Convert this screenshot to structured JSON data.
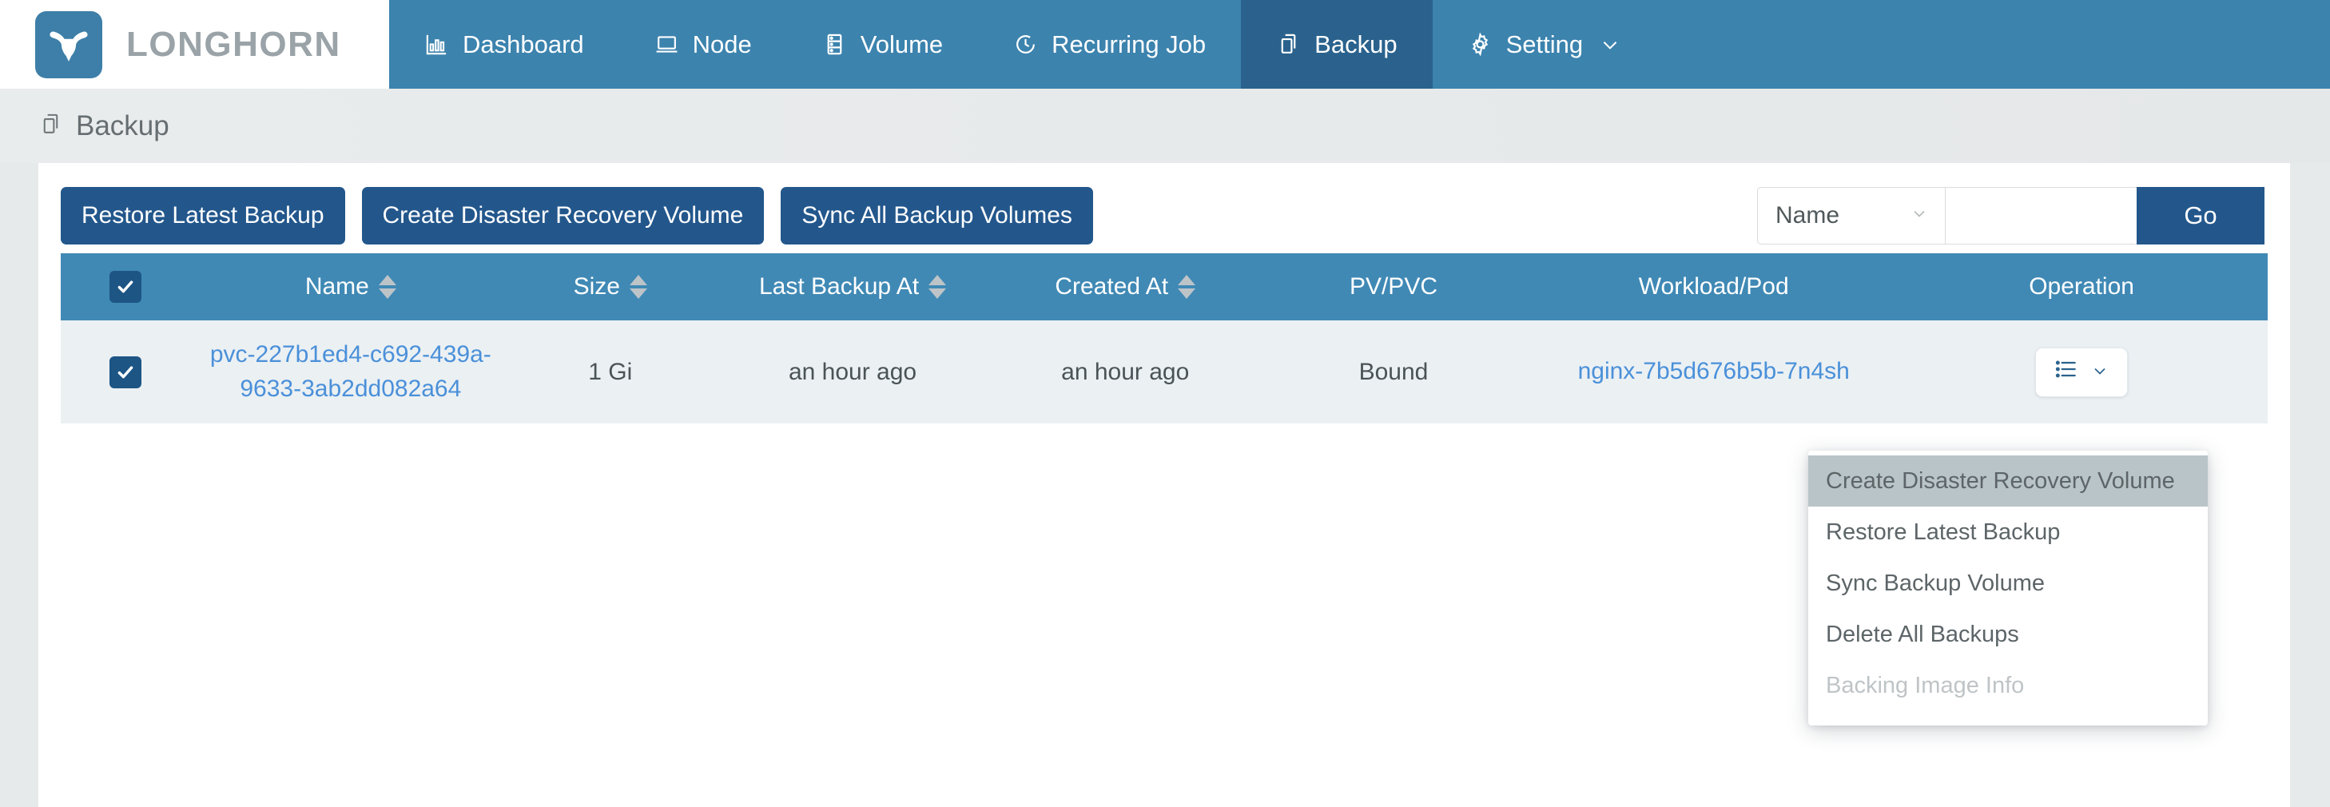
{
  "brand": {
    "name": "LONGHORN",
    "logo_icon": "longhorn-bull-icon"
  },
  "nav": {
    "items": [
      {
        "label": "Dashboard",
        "icon": "chart-bar-icon",
        "active": false
      },
      {
        "label": "Node",
        "icon": "laptop-icon",
        "active": false
      },
      {
        "label": "Volume",
        "icon": "server-stack-icon",
        "active": false
      },
      {
        "label": "Recurring Job",
        "icon": "clock-icon",
        "active": false
      },
      {
        "label": "Backup",
        "icon": "copy-icon",
        "active": true
      },
      {
        "label": "Setting",
        "icon": "gear-icon",
        "active": false,
        "caret": "⌄"
      }
    ]
  },
  "page": {
    "title": "Backup",
    "icon": "copy-icon"
  },
  "toolbar": {
    "buttons": [
      "Restore Latest Backup",
      "Create Disaster Recovery Volume",
      "Sync All Backup Volumes"
    ],
    "search": {
      "field_selected": "Name",
      "field_caret": "⌄",
      "query_value": "",
      "query_placeholder": "",
      "go_label": "Go"
    }
  },
  "table": {
    "select_all_checked": true,
    "columns": [
      {
        "label": "",
        "sortable": false
      },
      {
        "label": "Name",
        "sortable": true
      },
      {
        "label": "Size",
        "sortable": true
      },
      {
        "label": "Last Backup At",
        "sortable": true
      },
      {
        "label": "Created At",
        "sortable": true
      },
      {
        "label": "PV/PVC",
        "sortable": false
      },
      {
        "label": "Workload/Pod",
        "sortable": false
      },
      {
        "label": "Operation",
        "sortable": false
      }
    ],
    "rows": [
      {
        "checked": true,
        "name": "pvc-227b1ed4-c692-439a-9633-3ab2dd082a64",
        "size": "1 Gi",
        "last_backup_at": "an hour ago",
        "created_at": "an hour ago",
        "pv_pvc": "Bound",
        "workload_pod": "nginx-7b5d676b5b-7n4sh",
        "operation_icon": "list-menu-icon",
        "operation_caret": "⌄"
      }
    ]
  },
  "operation_menu": {
    "items": [
      {
        "label": "Create Disaster Recovery Volume",
        "state": "hovered"
      },
      {
        "label": "Restore Latest Backup",
        "state": "normal"
      },
      {
        "label": "Sync Backup Volume",
        "state": "normal"
      },
      {
        "label": "Delete All Backups",
        "state": "normal"
      },
      {
        "label": "Backing Image Info",
        "state": "disabled"
      }
    ]
  },
  "colors": {
    "navbar": "#3c83ae",
    "nav_active": "#2a628d",
    "primary_button": "#23578c",
    "table_header": "#4089b5",
    "row_background": "#ebf0f3",
    "link": "#4a90d9",
    "page_background": "#e7eaea",
    "checkbox": "#1d5585"
  }
}
